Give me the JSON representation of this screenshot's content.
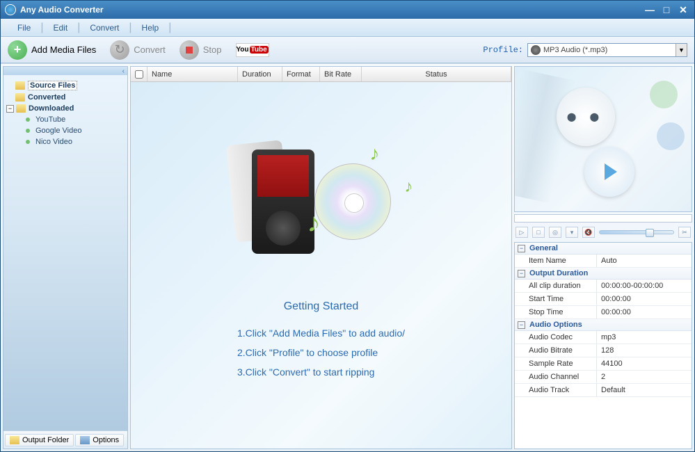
{
  "app": {
    "title": "Any Audio Converter"
  },
  "menu": {
    "file": "File",
    "edit": "Edit",
    "convert": "Convert",
    "help": "Help"
  },
  "toolbar": {
    "add": "Add Media Files",
    "convert": "Convert",
    "stop": "Stop",
    "profile_label": "Profile:",
    "profile_selected": "MP3 Audio (*.mp3)"
  },
  "tree": {
    "source_files": "Source Files",
    "converted": "Converted",
    "downloaded": "Downloaded",
    "youtube": "YouTube",
    "google_video": "Google Video",
    "nico_video": "Nico Video"
  },
  "sidebar_footer": {
    "output_folder": "Output Folder",
    "options": "Options"
  },
  "list": {
    "name": "Name",
    "duration": "Duration",
    "format": "Format",
    "bitrate": "Bit Rate",
    "status": "Status"
  },
  "getting_started": {
    "title": "Getting Started",
    "s1": "1.Click \"Add Media Files\" to add audio/",
    "s2": "2.Click \"Profile\" to choose profile",
    "s3": "3.Click \"Convert\" to start ripping"
  },
  "props": {
    "general": "General",
    "item_name": "Item Name",
    "item_name_v": "Auto",
    "output_duration": "Output Duration",
    "all_clip": "All clip duration",
    "all_clip_v": "00:00:00-00:00:00",
    "start_time": "Start Time",
    "start_time_v": "00:00:00",
    "stop_time": "Stop Time",
    "stop_time_v": "00:00:00",
    "audio_options": "Audio Options",
    "codec": "Audio Codec",
    "codec_v": "mp3",
    "bitrate": "Audio Bitrate",
    "bitrate_v": "128",
    "sample": "Sample Rate",
    "sample_v": "44100",
    "channel": "Audio Channel",
    "channel_v": "2",
    "track": "Audio Track",
    "track_v": "Default"
  }
}
